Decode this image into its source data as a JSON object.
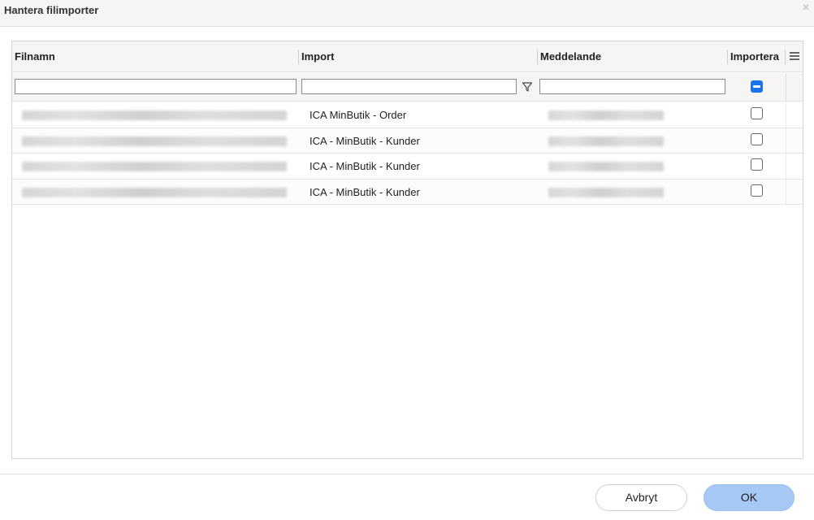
{
  "dialog": {
    "title": "Hantera filimporter",
    "close_symbol": "×"
  },
  "grid": {
    "columns": [
      {
        "key": "filename",
        "label": "Filnamn"
      },
      {
        "key": "import",
        "label": "Import"
      },
      {
        "key": "message",
        "label": "Meddelande"
      },
      {
        "key": "importera",
        "label": "Importera"
      }
    ],
    "filters": {
      "filename_value": "",
      "import_value": "",
      "message_value": "",
      "select_all_state": "indeterminate"
    },
    "rows": [
      {
        "filename": "[blurred]",
        "import": "ICA MinButik - Order",
        "message": "[blurred]",
        "checked": false
      },
      {
        "filename": "[blurred]",
        "import": "ICA - MinButik - Kunder",
        "message": "[blurred]",
        "checked": false
      },
      {
        "filename": "[blurred]",
        "import": "ICA - MinButik - Kunder",
        "message": "[blurred]",
        "checked": false
      },
      {
        "filename": "[blurred]",
        "import": "ICA - MinButik - Kunder",
        "message": "[blurred]",
        "checked": false
      }
    ]
  },
  "footer": {
    "cancel_label": "Avbryt",
    "ok_label": "OK"
  },
  "colors": {
    "accent": "#1a73e8",
    "ok_button": "#a6c8f5",
    "header_bg": "#f6f5f3"
  },
  "icons": {
    "close": "close-icon",
    "column_menu": "menu-icon",
    "filter": "filter-funnel-icon"
  }
}
